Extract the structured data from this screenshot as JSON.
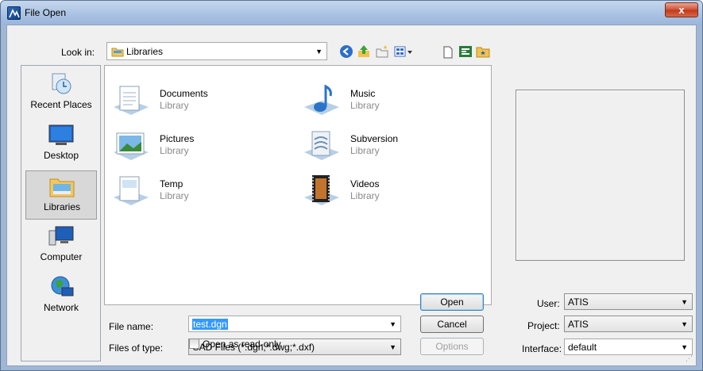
{
  "window": {
    "title": "File Open",
    "close_label": "x"
  },
  "lookin": {
    "label": "Look in:",
    "value": "Libraries"
  },
  "toolbar": {
    "icons": [
      "back-icon",
      "up-folder-icon",
      "new-folder-icon",
      "views-menu-icon",
      "new-file-icon",
      "refresh-icon",
      "favorites-icon"
    ]
  },
  "places": [
    {
      "label": "Recent Places",
      "icon": "recent-places-icon"
    },
    {
      "label": "Desktop",
      "icon": "desktop-icon"
    },
    {
      "label": "Libraries",
      "icon": "libraries-icon",
      "selected": true
    },
    {
      "label": "Computer",
      "icon": "computer-icon"
    },
    {
      "label": "Network",
      "icon": "network-icon"
    }
  ],
  "files": [
    {
      "name": "Documents",
      "type": "Library",
      "icon": "documents-library-icon"
    },
    {
      "name": "Music",
      "type": "Library",
      "icon": "music-library-icon"
    },
    {
      "name": "Pictures",
      "type": "Library",
      "icon": "pictures-library-icon"
    },
    {
      "name": "Subversion",
      "type": "Library",
      "icon": "subversion-library-icon"
    },
    {
      "name": "Temp",
      "type": "Library",
      "icon": "temp-library-icon"
    },
    {
      "name": "Videos",
      "type": "Library",
      "icon": "videos-library-icon"
    }
  ],
  "form": {
    "filename_label": "File name:",
    "filename_value": "test.dgn",
    "filetype_label": "Files of type:",
    "filetype_value": "CAD Files (*.dgn;*.dwg;*.dxf)",
    "readonly_label": "Open as read-only",
    "readonly_checked": false
  },
  "buttons": {
    "open": "Open",
    "cancel": "Cancel",
    "options": "Options"
  },
  "settings": {
    "user_label": "User:",
    "user_value": "ATIS",
    "project_label": "Project:",
    "project_value": "ATIS",
    "interface_label": "Interface:",
    "interface_value": "default"
  }
}
